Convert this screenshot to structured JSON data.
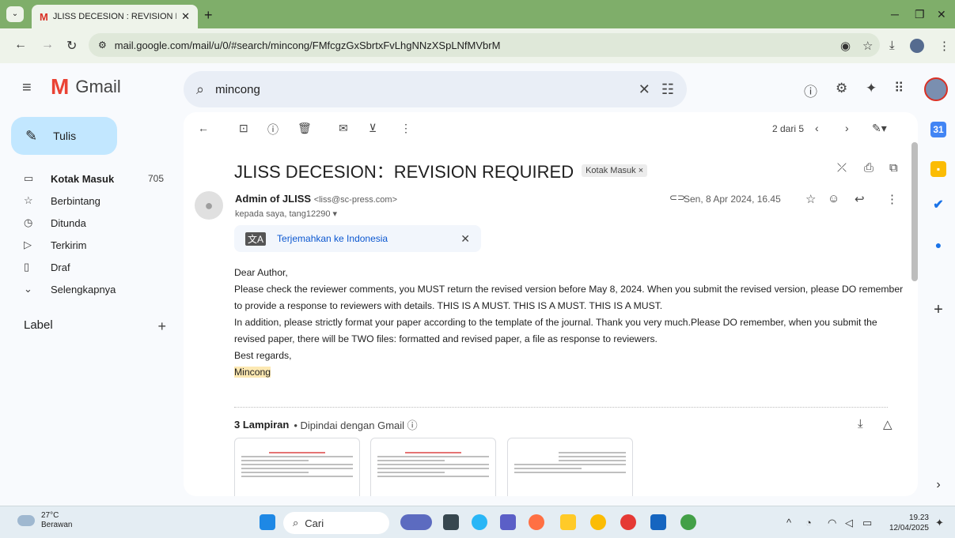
{
  "browser": {
    "tab_title": "JLISS DECESION : REVISION RE",
    "tab_gmail_letter": "M",
    "url": "mail.google.com/mail/u/0/#search/mincong/FMfcgzGxSbrtxFvLhgNNzXSpLNfMVbrM"
  },
  "gmail": {
    "app_name": "Gmail",
    "search_query": "mincong",
    "compose_label": "Tulis",
    "nav": [
      {
        "label": "Kotak Masuk",
        "count": "705",
        "icon": "inbox-icon"
      },
      {
        "label": "Berbintang",
        "count": "",
        "icon": "star-icon"
      },
      {
        "label": "Ditunda",
        "count": "",
        "icon": "clock-icon"
      },
      {
        "label": "Terkirim",
        "count": "",
        "icon": "send-icon"
      },
      {
        "label": "Draf",
        "count": "",
        "icon": "draft-icon"
      },
      {
        "label": "Selengkapnya",
        "count": "",
        "icon": "chevron-down-icon"
      }
    ],
    "labels_header": "Label"
  },
  "toolbar": {
    "pagination": "2 dari 5"
  },
  "message": {
    "subject": "JLISS DECESION：REVISION REQUIRED",
    "label_badge": "Kotak Masuk ×",
    "sender_name": "Admin of JLISS",
    "sender_email": "<liss@sc-press.com>",
    "to_line": "kepada saya, tang12290 ▾",
    "date": "Sen, 8 Apr 2024, 16.45",
    "translate_link": "Terjemahkan ke Indonesia",
    "body": [
      "Dear Author,",
      "Please check the reviewer comments, you MUST return the revised version before May 8, 2024. When you submit the revised version, please DO remember to provide a response to reviewers with details. THIS IS A MUST. THIS IS A MUST. THIS IS A MUST.",
      "In addition, please strictly format your paper according to the template of the journal. Thank you very much.Please DO remember, when you submit the revised paper, there will be TWO files: formatted and revised paper, a file as response to reviewers.",
      "Best regards,",
      "Mincong"
    ],
    "attachments_count": "3 Lampiran",
    "attachments_scan": "•  Dipindai dengan Gmail ⓘ"
  },
  "taskbar": {
    "temperature": "27°C",
    "weather": "Berawan",
    "search_label": "Cari",
    "time": "19.23",
    "date": "12/04/2025"
  },
  "colors": {
    "tab_strip": "#7fae6a",
    "compose_bg": "#c2e7ff",
    "link": "#0b57d0",
    "highlight": "#fce8b2"
  }
}
